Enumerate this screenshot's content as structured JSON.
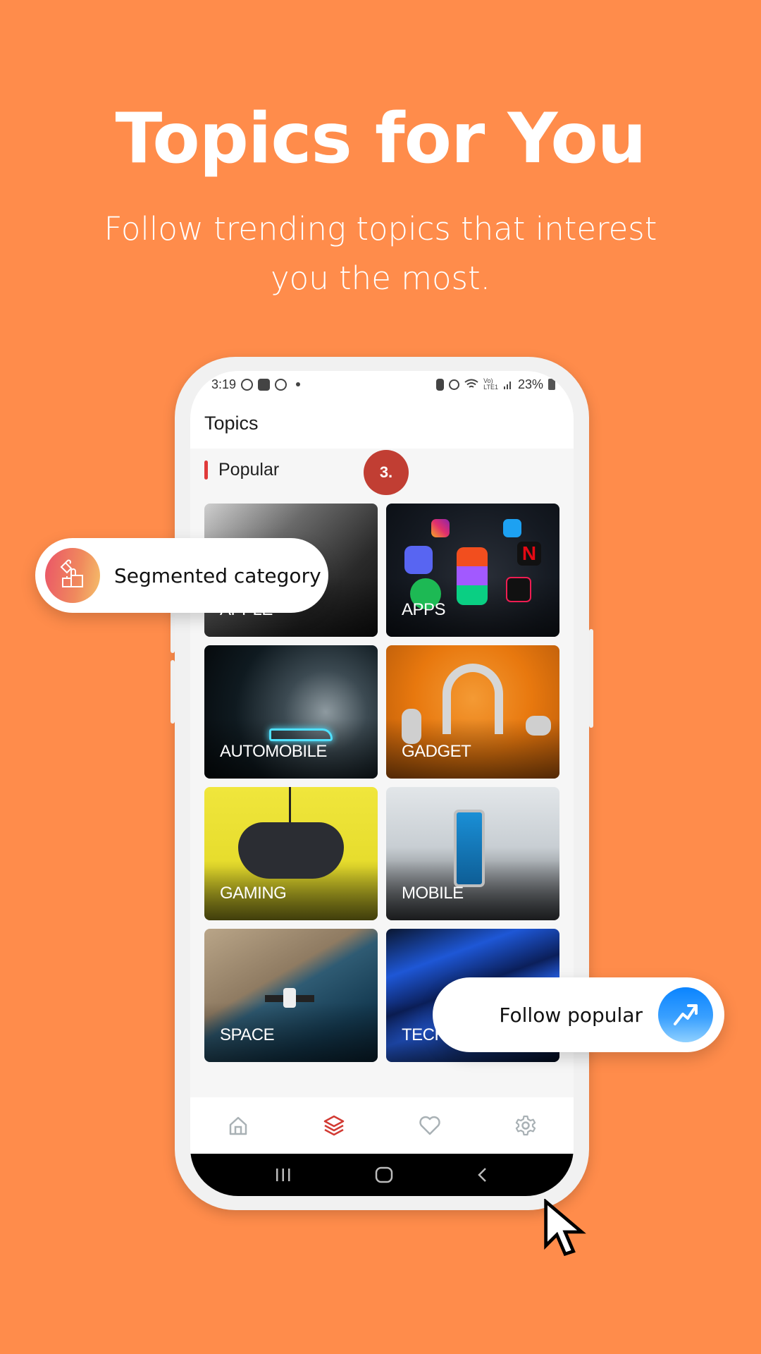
{
  "hero": {
    "title": "Topics for You",
    "subtitle": "Follow trending topics that interest you the most."
  },
  "phone": {
    "status_bar": {
      "time": "3:19",
      "left_icons": [
        "threads-icon",
        "gallery-icon",
        "whatsapp-icon",
        "notification-dot"
      ],
      "right_icons": [
        "battery-saver-icon",
        "alarm-icon",
        "wifi-icon",
        "volte-lte-icon",
        "signal-icon"
      ],
      "battery": "23%"
    },
    "app_bar": {
      "title": "Topics"
    },
    "section": {
      "title": "Popular",
      "accent_color": "#E03A3A"
    },
    "step_badge": {
      "label": "3.",
      "color": "#C13E33"
    },
    "topics": [
      {
        "label": "APPLE"
      },
      {
        "label": "APPS"
      },
      {
        "label": "AUTOMOBILE"
      },
      {
        "label": "GADGET"
      },
      {
        "label": "GAMING"
      },
      {
        "label": "MOBILE"
      },
      {
        "label": "SPACE"
      },
      {
        "label": "TECH"
      }
    ],
    "bottom_nav": [
      {
        "name": "home",
        "icon": "home-icon",
        "active": false
      },
      {
        "name": "topics",
        "icon": "layers-icon",
        "active": true
      },
      {
        "name": "favorites",
        "icon": "heart-icon",
        "active": false
      },
      {
        "name": "settings",
        "icon": "gear-icon",
        "active": false
      }
    ],
    "bottom_nav_active_color": "#D23A33",
    "bottom_nav_inactive_color": "#A9B1B5",
    "system_nav": [
      "recents-icon",
      "home-button-icon",
      "back-icon"
    ]
  },
  "callouts": {
    "segmented": {
      "label": "Segmented category",
      "icon": "puzzle-icon"
    },
    "follow": {
      "label": "Follow popular",
      "icon": "trending-up-icon"
    }
  },
  "colors": {
    "background": "#FF8C4B",
    "text_on_background": "#FFFFFF"
  }
}
